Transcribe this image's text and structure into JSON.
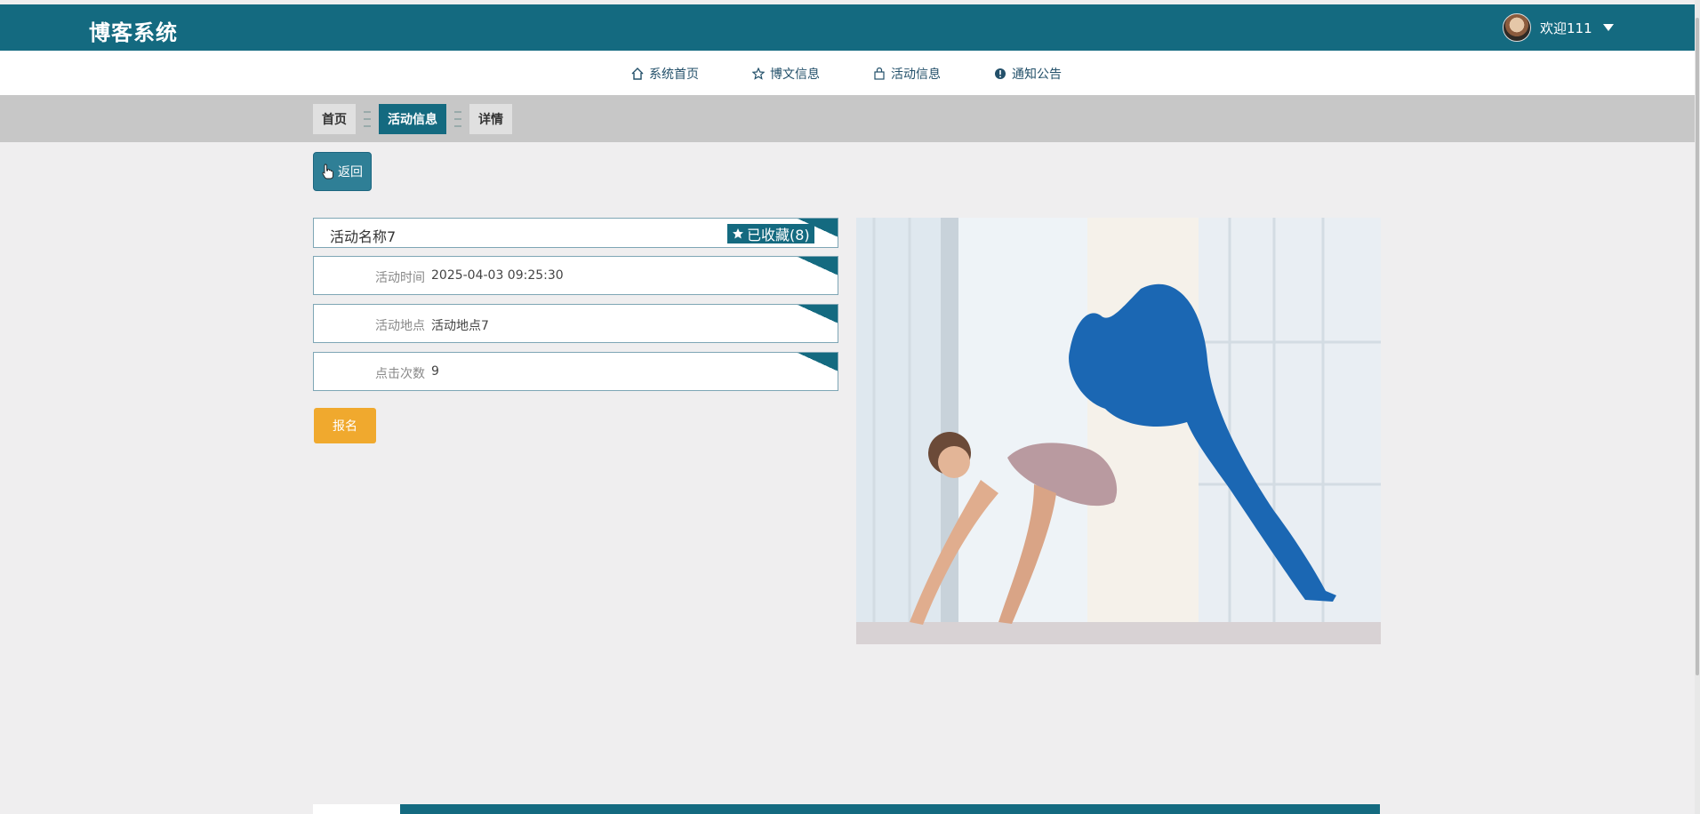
{
  "header": {
    "brand": "博客系统",
    "welcome": "欢迎111"
  },
  "nav": {
    "items": [
      {
        "label": "系统首页",
        "icon": "home-icon"
      },
      {
        "label": "博文信息",
        "icon": "star-icon"
      },
      {
        "label": "活动信息",
        "icon": "bag-icon"
      },
      {
        "label": "通知公告",
        "icon": "alert-icon"
      }
    ]
  },
  "breadcrumb": {
    "home": "首页",
    "section": "活动信息",
    "detail": "详情"
  },
  "actions": {
    "back": "返回",
    "signup": "报名"
  },
  "activity": {
    "name": "活动名称7",
    "favorite_label": "已收藏(8)",
    "fields": [
      {
        "label": "活动时间",
        "value": "2025-04-03 09:25:30"
      },
      {
        "label": "活动地点",
        "value": "活动地点7"
      },
      {
        "label": "点击次数",
        "value": "9"
      }
    ]
  },
  "colors": {
    "primary": "#146a80",
    "accent": "#f0a92e",
    "background": "#efeeef"
  }
}
